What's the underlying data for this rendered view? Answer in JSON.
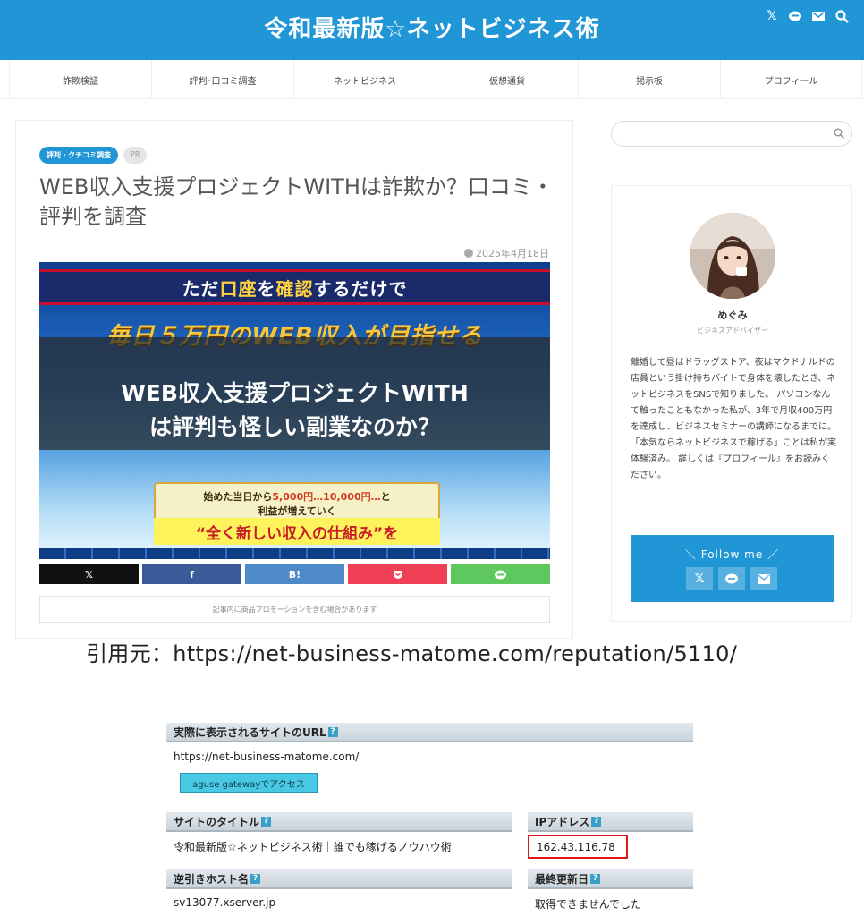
{
  "header": {
    "site_title": "令和最新版☆ネットビジネス術",
    "icons": [
      "x-icon",
      "line-icon",
      "mail-icon",
      "search-icon"
    ]
  },
  "nav": {
    "items": [
      "詐欺検証",
      "評判･口コミ調査",
      "ネットビジネス",
      "仮想通貨",
      "掲示板",
      "プロフィール"
    ]
  },
  "article": {
    "category": "評判・クチコミ調査",
    "pr_label": "PR",
    "title": "WEB収入支援プロジェクトWITHは詐欺か？口コミ・評判を調査",
    "date": "2025年4月18日",
    "eyecatch": {
      "line1_a": "ただ",
      "line1_hl1": "口座",
      "line1_b": "を",
      "line1_hl2": "確認",
      "line1_c": "するだけで",
      "line2": "毎日５万円のWEB収入が目指せる",
      "caption_1": "WEB収入支援プロジェクトWITH",
      "caption_2": "は評判も怪しい副業なのか？",
      "box_a": "始めた当日から",
      "box_red": "5,000円…10,000円…",
      "box_b": "と",
      "box_line2": "利益が増えていく",
      "yellow_line": "“全く新しい収入の仕組み”を"
    },
    "share": {
      "x": "𝕏",
      "facebook": "f",
      "hatena": "B!"
    },
    "promo_note": "記事内に商品プロモーションを含む場合があります"
  },
  "sidebar": {
    "search_placeholder": "",
    "profile": {
      "name": "めぐみ",
      "role": "ビジネスアドバイザー",
      "bio": "離婚して昼はドラッグストア、夜はマクドナルドの店員という掛け持ちバイトで身体を壊したとき、ネットビジネスをSNSで知りました。 パソコンなんて触ったこともなかった私が、3年で月収400万円を達成し、ビジネスセミナーの講師になるまでに。 「本気ならネットビジネスで稼げる」ことは私が実体験済み。 詳しくは『プロフィール』をお読みください。"
    },
    "follow": {
      "title": "＼ Follow me ／",
      "icons": [
        "x-icon",
        "line-icon",
        "mail-icon"
      ]
    }
  },
  "source": {
    "text": "引用元：https://net-business-matome.com/reputation/5110/"
  },
  "aguse": {
    "url_label": "実際に表示されるサイトのURL",
    "url_value": "https://net-business-matome.com/",
    "button_label": "aguse gatewayでアクセス",
    "title_label": "サイトのタイトル",
    "title_value": "令和最新版☆ネットビジネス術｜誰でも稼げるノウハウ術",
    "ip_label": "IPアドレス",
    "ip_value": "162.43.116.78",
    "host_label": "逆引きホスト名",
    "host_value": "sv13077.xserver.jp",
    "updated_label": "最終更新日",
    "updated_value": "取得できませんでした",
    "help_mark": "?"
  },
  "colors": {
    "brand_blue": "#2196d6",
    "highlight_red": "#e0181b"
  }
}
